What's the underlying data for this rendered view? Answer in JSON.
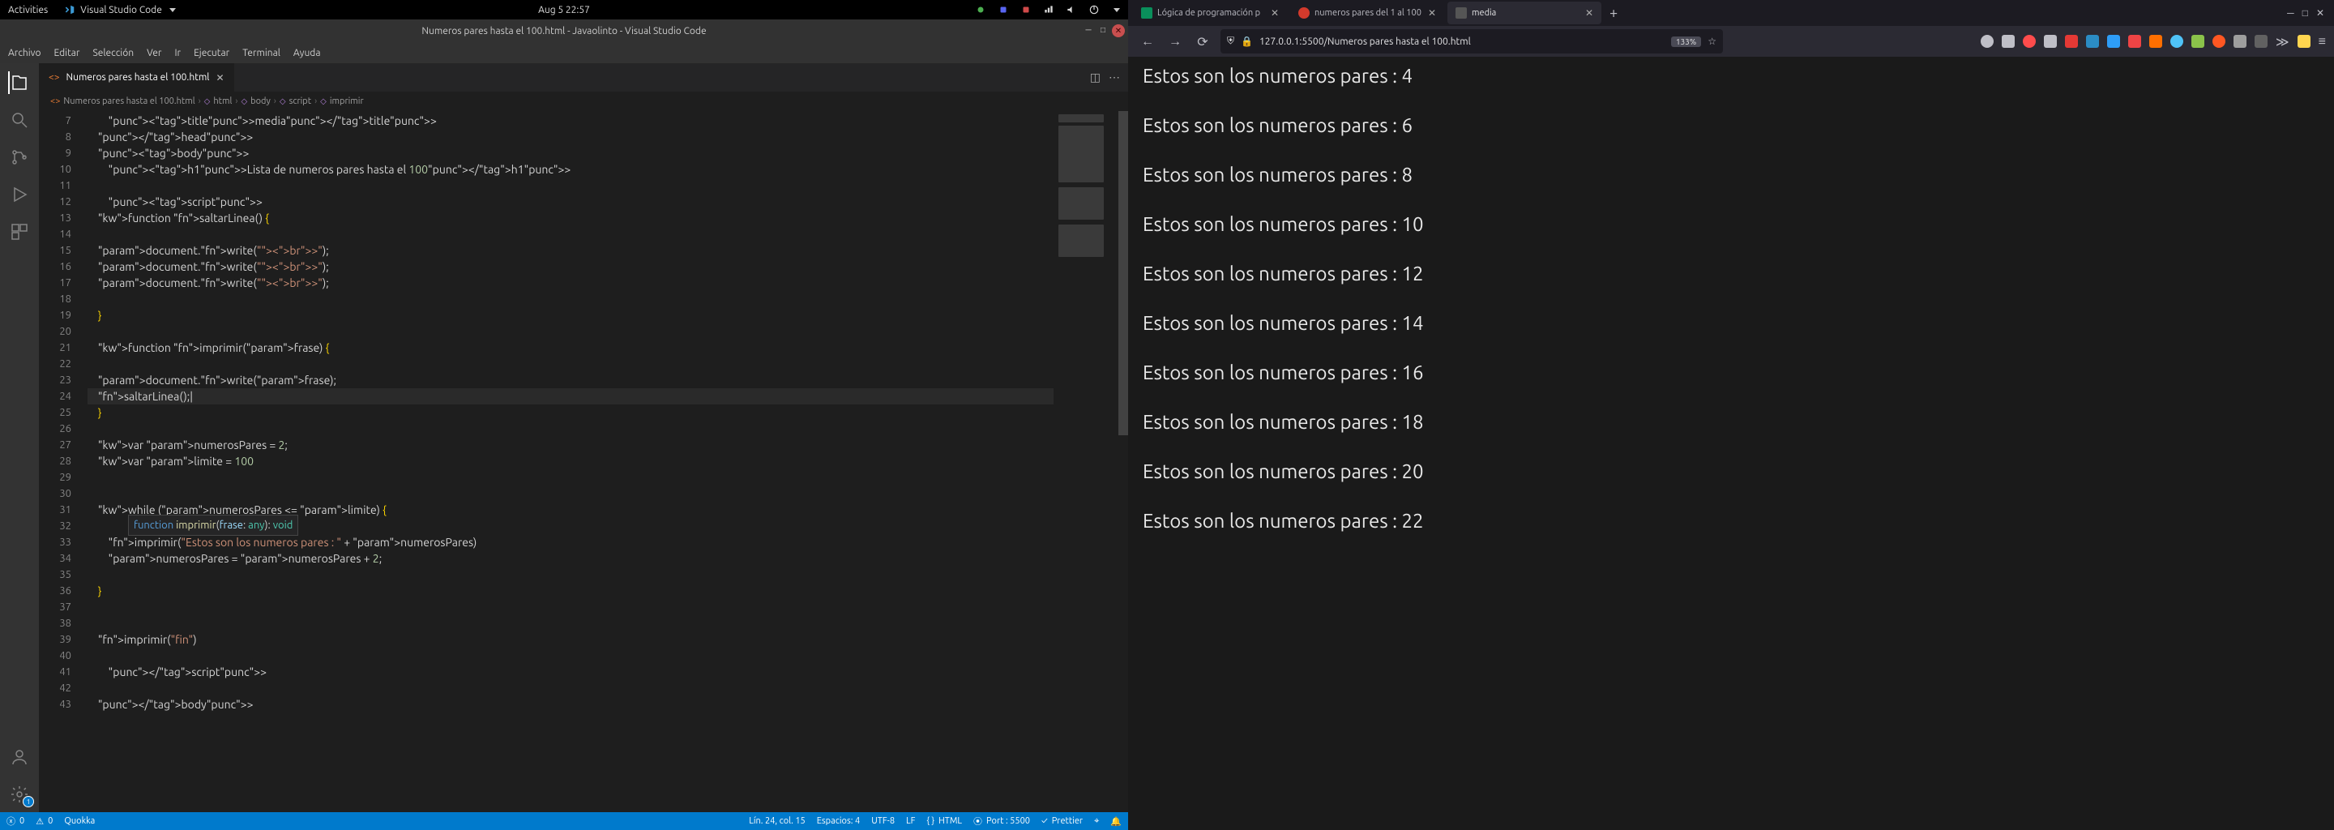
{
  "gnome": {
    "activities": "Activities",
    "app": "Visual Studio Code",
    "time": "Aug 5  22:57"
  },
  "vscode": {
    "title": "Numeros pares hasta el 100.html - Javaolinto - Visual Studio Code",
    "menu": [
      "Archivo",
      "Editar",
      "Selección",
      "Ver",
      "Ir",
      "Ejecutar",
      "Terminal",
      "Ayuda"
    ],
    "tab": {
      "name": "Numeros pares hasta el 100.html"
    },
    "breadcrumb": [
      "Numeros pares hasta el 100.html",
      "html",
      "body",
      "script",
      "imprimir"
    ],
    "hint": "function imprimir(frase: any): void",
    "status": {
      "errors": "0",
      "warnings": "0",
      "quokka": "Quokka",
      "pos": "Lín. 24, col. 15",
      "spaces": "Espacios: 4",
      "enc": "UTF-8",
      "eol": "LF",
      "lang": "HTML",
      "port": "Port : 5500",
      "prettier": "Prettier"
    },
    "code": {
      "first_line": 7,
      "lines": [
        "        <title>media</title>",
        "    </head>",
        "    <body>",
        "        <h1>Lista de numeros pares hasta el 100</h1>",
        "",
        "        <script>",
        "    function saltarLinea() {",
        "",
        "    document.write(\"<br>\");",
        "    document.write(\"<br>\");",
        "    document.write(\"<br>\");",
        "",
        "    }",
        "",
        "    function imprimir(frase) {",
        "",
        "    document.write(frase);",
        "    saltarLinea();|",
        "    }",
        "",
        "    var numerosPares = 2;",
        "    var limite = 100",
        "",
        "",
        "    while (numerosPares <= limite) {",
        "",
        "        imprimir(\"Estos son los numeros pares : \" + numerosPares)",
        "        numerosPares = numerosPares + 2;",
        "",
        "    }",
        "",
        "",
        "    imprimir(\"fin\")",
        "",
        "        </scr ipt>",
        "",
        "    </body>"
      ]
    }
  },
  "firefox": {
    "tabs": [
      {
        "title": "Lógica de programación p"
      },
      {
        "title": "numeros pares del 1 al 100"
      },
      {
        "title": "media"
      }
    ],
    "url": "127.0.0.1:5500/Numeros pares hasta el 100.html",
    "zoom": "133%",
    "output_prefix": "Estos son los numeros pares : ",
    "output_values": [
      4,
      6,
      8,
      10,
      12,
      14,
      16,
      18,
      20,
      22
    ]
  }
}
